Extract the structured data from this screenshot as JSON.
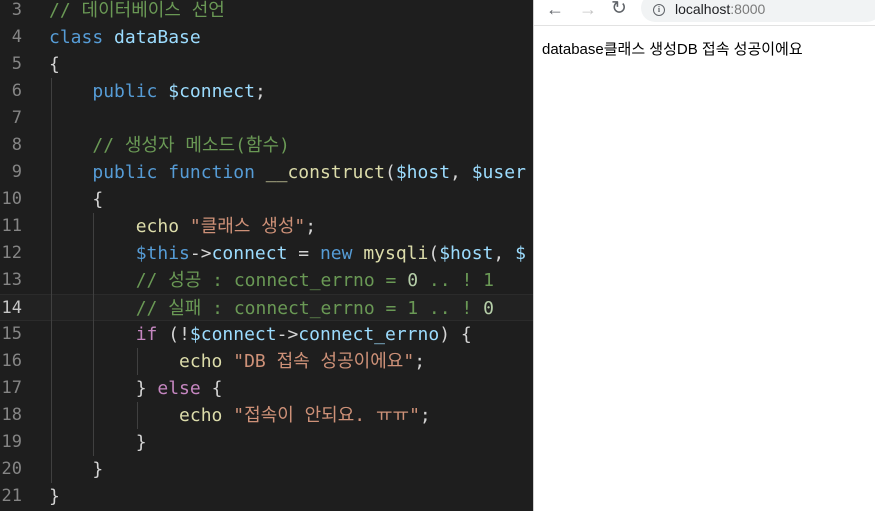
{
  "editor": {
    "lines": [
      {
        "n": "3",
        "tokens": [
          {
            "c": "cmt",
            "t": "// 데이터베이스 선언"
          }
        ]
      },
      {
        "n": "4",
        "tokens": [
          {
            "c": "kw",
            "t": "class"
          },
          {
            "c": "txt",
            "t": " "
          },
          {
            "c": "var",
            "t": "dataBase"
          }
        ]
      },
      {
        "n": "5",
        "tokens": [
          {
            "c": "txt",
            "t": "{"
          }
        ]
      },
      {
        "n": "6",
        "tokens": [
          {
            "c": "txt",
            "t": "    "
          },
          {
            "c": "kw",
            "t": "public"
          },
          {
            "c": "txt",
            "t": " "
          },
          {
            "c": "var",
            "t": "$connect"
          },
          {
            "c": "txt",
            "t": ";"
          }
        ]
      },
      {
        "n": "7",
        "tokens": []
      },
      {
        "n": "8",
        "tokens": [
          {
            "c": "txt",
            "t": "    "
          },
          {
            "c": "cmt",
            "t": "// 생성자 메소드(함수)"
          }
        ]
      },
      {
        "n": "9",
        "tokens": [
          {
            "c": "txt",
            "t": "    "
          },
          {
            "c": "kw",
            "t": "public"
          },
          {
            "c": "txt",
            "t": " "
          },
          {
            "c": "kw",
            "t": "function"
          },
          {
            "c": "txt",
            "t": " "
          },
          {
            "c": "fn",
            "t": "__construct"
          },
          {
            "c": "txt",
            "t": "("
          },
          {
            "c": "var",
            "t": "$host"
          },
          {
            "c": "txt",
            "t": ", "
          },
          {
            "c": "var",
            "t": "$user"
          }
        ]
      },
      {
        "n": "10",
        "tokens": [
          {
            "c": "txt",
            "t": "    {"
          }
        ]
      },
      {
        "n": "11",
        "tokens": [
          {
            "c": "txt",
            "t": "        "
          },
          {
            "c": "fn",
            "t": "echo"
          },
          {
            "c": "txt",
            "t": " "
          },
          {
            "c": "str",
            "t": "\"클래스 생성\""
          },
          {
            "c": "txt",
            "t": ";"
          }
        ]
      },
      {
        "n": "12",
        "tokens": [
          {
            "c": "txt",
            "t": "        "
          },
          {
            "c": "kw",
            "t": "$this"
          },
          {
            "c": "txt",
            "t": "->"
          },
          {
            "c": "var",
            "t": "connect"
          },
          {
            "c": "txt",
            "t": " = "
          },
          {
            "c": "kw",
            "t": "new"
          },
          {
            "c": "txt",
            "t": " "
          },
          {
            "c": "fn",
            "t": "mysqli"
          },
          {
            "c": "txt",
            "t": "("
          },
          {
            "c": "var",
            "t": "$host"
          },
          {
            "c": "txt",
            "t": ", "
          },
          {
            "c": "var",
            "t": "$"
          }
        ]
      },
      {
        "n": "13",
        "tokens": [
          {
            "c": "txt",
            "t": "        "
          },
          {
            "c": "cmt",
            "t": "// 성공 : connect_errno = "
          },
          {
            "c": "num",
            "t": "0"
          },
          {
            "c": "cmt",
            "t": " .. ! 1"
          }
        ]
      },
      {
        "n": "14",
        "current": true,
        "tokens": [
          {
            "c": "txt",
            "t": "        "
          },
          {
            "c": "cmt",
            "t": "// 실패 : connect_errno = 1 .. ! "
          },
          {
            "c": "num",
            "t": "0"
          }
        ]
      },
      {
        "n": "15",
        "tokens": [
          {
            "c": "txt",
            "t": "        "
          },
          {
            "c": "ctl",
            "t": "if"
          },
          {
            "c": "txt",
            "t": " (!"
          },
          {
            "c": "var",
            "t": "$connect"
          },
          {
            "c": "txt",
            "t": "->"
          },
          {
            "c": "var",
            "t": "connect_errno"
          },
          {
            "c": "txt",
            "t": ") {"
          }
        ]
      },
      {
        "n": "16",
        "tokens": [
          {
            "c": "txt",
            "t": "            "
          },
          {
            "c": "fn",
            "t": "echo"
          },
          {
            "c": "txt",
            "t": " "
          },
          {
            "c": "str",
            "t": "\"DB 접속 성공이에요\""
          },
          {
            "c": "txt",
            "t": ";"
          }
        ]
      },
      {
        "n": "17",
        "tokens": [
          {
            "c": "txt",
            "t": "        } "
          },
          {
            "c": "ctl",
            "t": "else"
          },
          {
            "c": "txt",
            "t": " {"
          }
        ]
      },
      {
        "n": "18",
        "tokens": [
          {
            "c": "txt",
            "t": "            "
          },
          {
            "c": "fn",
            "t": "echo"
          },
          {
            "c": "txt",
            "t": " "
          },
          {
            "c": "str",
            "t": "\"접속이 안되요. ㅠㅠ\""
          },
          {
            "c": "txt",
            "t": ";"
          }
        ]
      },
      {
        "n": "19",
        "tokens": [
          {
            "c": "txt",
            "t": "        }"
          }
        ]
      },
      {
        "n": "20",
        "tokens": [
          {
            "c": "txt",
            "t": "    }"
          }
        ]
      },
      {
        "n": "21",
        "tokens": [
          {
            "c": "txt",
            "t": "}"
          }
        ]
      }
    ]
  },
  "browser": {
    "url_host": "localhost",
    "url_port": ":8000",
    "back_icon": "arrow-left-icon",
    "forward_icon": "arrow-right-icon",
    "reload_icon": "reload-icon",
    "info_icon": "info-icon",
    "page_text": "database클래스 생성DB 접속 성공이에요"
  }
}
